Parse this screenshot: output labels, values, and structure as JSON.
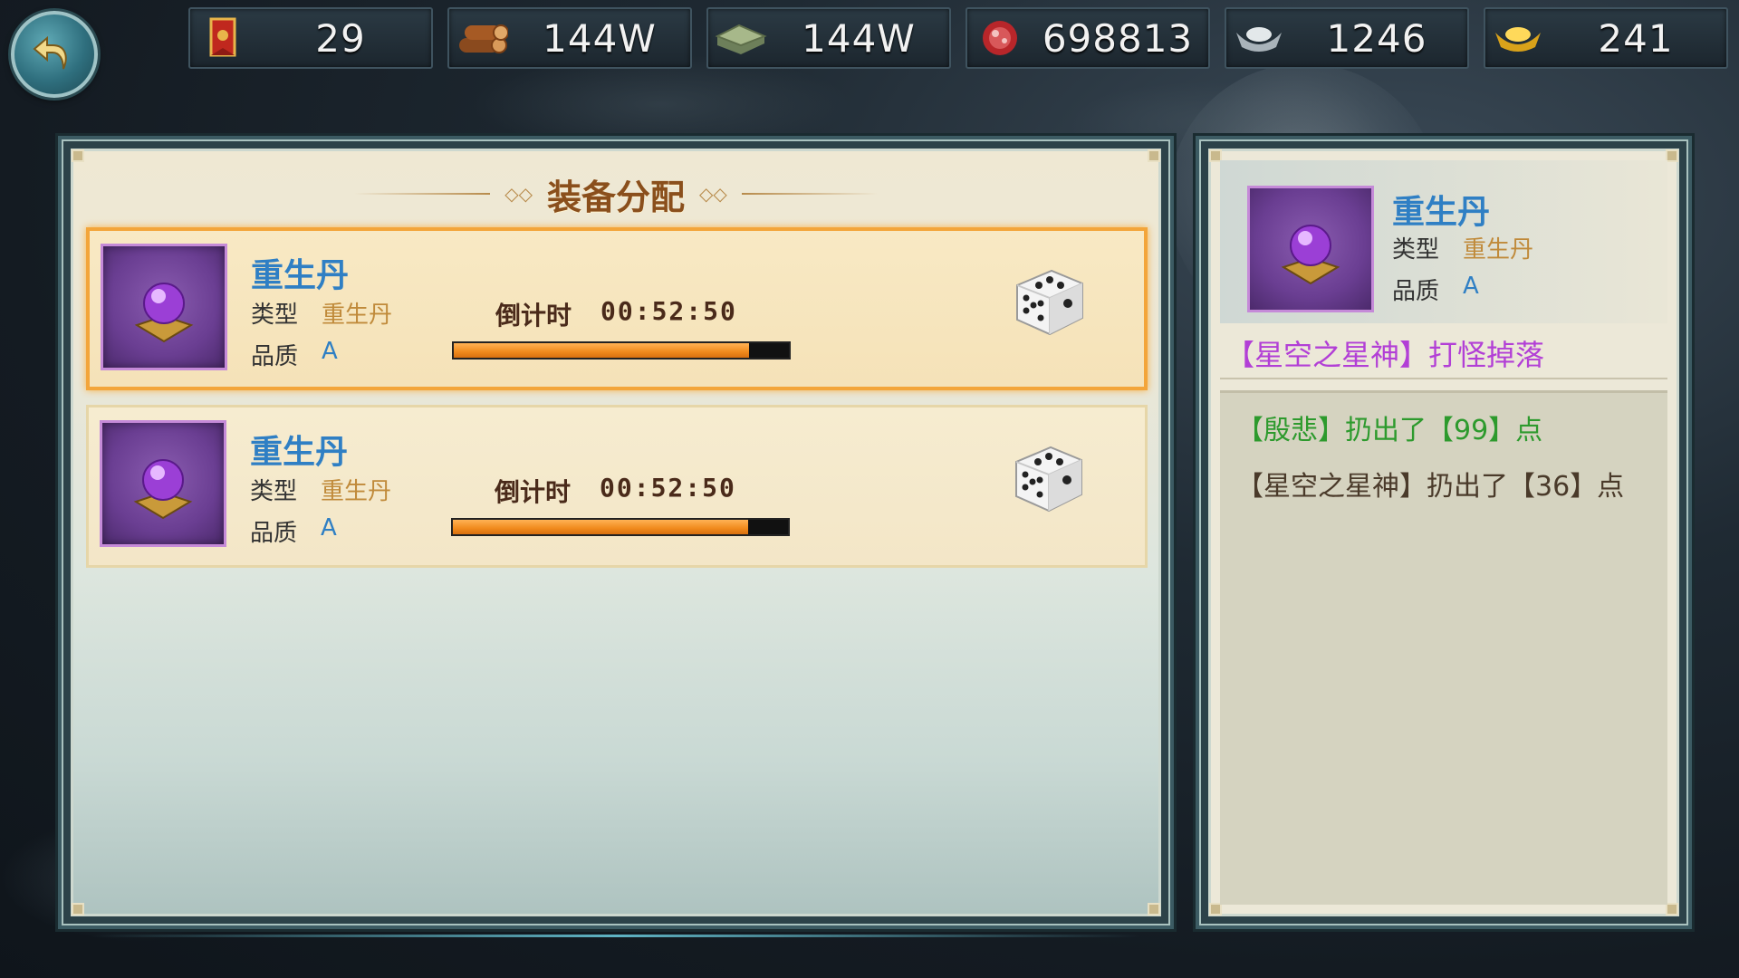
{
  "resources": [
    {
      "icon": "red-banner-icon",
      "value": "29"
    },
    {
      "icon": "wood-logs-icon",
      "value": "144W"
    },
    {
      "icon": "stone-slab-icon",
      "value": "144W"
    },
    {
      "icon": "meat-icon",
      "value": "698813"
    },
    {
      "icon": "silver-ingot-icon",
      "value": "1246"
    },
    {
      "icon": "gold-ingot-icon",
      "value": "241"
    }
  ],
  "panel": {
    "title": "装备分配",
    "items": [
      {
        "name": "重生丹",
        "type_label": "类型",
        "type_value": "重生丹",
        "quality_label": "品质",
        "quality_value": "A",
        "countdown_label": "倒计时",
        "countdown_value": "00:52:50",
        "progress": 0.88
      },
      {
        "name": "重生丹",
        "type_label": "类型",
        "type_value": "重生丹",
        "quality_label": "品质",
        "quality_value": "A",
        "countdown_label": "倒计时",
        "countdown_value": "00:52:50",
        "progress": 0.88
      }
    ]
  },
  "detail": {
    "name": "重生丹",
    "type_label": "类型",
    "type_value": "重生丹",
    "quality_label": "品质",
    "quality_value": "A",
    "source": "【星空之星神】打怪掉落",
    "log": [
      {
        "text": "【殷悲】扔出了【99】点",
        "color": "green"
      },
      {
        "text": "【星空之星神】扔出了【36】点",
        "color": "dark"
      }
    ]
  },
  "colors": {
    "name_blue": "#2f7fc4",
    "type_gold": "#c08a3a",
    "title_brown": "#8a4f1c",
    "source_purple": "#b23fd6",
    "log_green": "#2d9a2d",
    "progress_orange": "#f08a1c",
    "selected_border": "#f3a53a"
  }
}
